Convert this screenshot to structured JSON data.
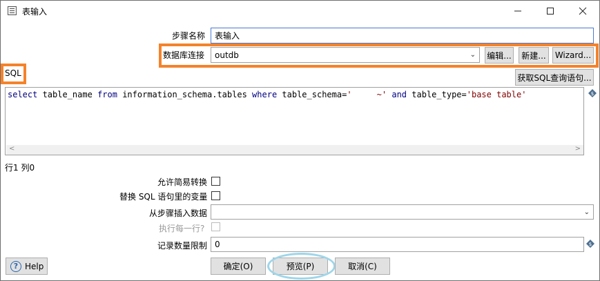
{
  "window": {
    "title": "表输入"
  },
  "step_name": {
    "label": "步骤名称",
    "value": "表输入"
  },
  "db_connection": {
    "label": "数据库连接",
    "value": "outdb",
    "edit_label": "编辑...",
    "new_label": "新建...",
    "wizard_label": "Wizard..."
  },
  "sql": {
    "label": "SQL",
    "get_sql_label": "获取SQL查询语句...",
    "parts": {
      "p1": "select",
      "p2": " table_name ",
      "p3": "from",
      "p4": " information_schema.tables ",
      "p5": "where",
      "p6": " table_schema=",
      "p7": "'     ~'",
      "p8": " ",
      "p9": "and",
      "p10": " table_type=",
      "p11": "'base table'"
    },
    "status": "行1 列0"
  },
  "options": {
    "lazy_conversion_label": "允许简易转换",
    "replace_vars_label": "替换 SQL 语句里的变量",
    "insert_from_step_label": "从步骤插入数据",
    "execute_each_row_label": "执行每一行?",
    "limit_label": "记录数量限制",
    "limit_value": "0"
  },
  "buttons": {
    "help": "Help",
    "ok": "确定(O)",
    "preview": "预览(P)",
    "cancel": "取消(C)"
  },
  "icons": {
    "app": "table-input-icon",
    "minimize": "minimize-icon",
    "maximize": "maximize-icon",
    "close": "close-icon",
    "variable": "variable-diamond-icon",
    "help": "help-circle-icon"
  },
  "colors": {
    "highlight_box": "#f5822a",
    "preview_ring": "#9ed6ea",
    "sql_keyword": "#000080",
    "sql_string": "#800000"
  }
}
